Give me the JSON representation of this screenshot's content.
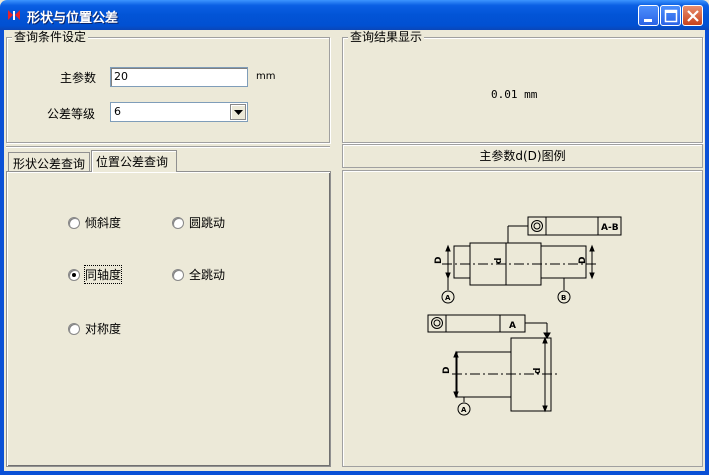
{
  "window": {
    "title": "形状与位置公差",
    "controls": {
      "minimize": "minimize",
      "maximize": "maximize",
      "close": "close"
    }
  },
  "query_settings": {
    "title": "查询条件设定",
    "main_param_label": "主参数",
    "main_param_value": "20",
    "main_param_unit": "mm",
    "grade_label": "公差等级",
    "grade_value": "6"
  },
  "tabs": [
    {
      "label": "形状公差查询",
      "active": false
    },
    {
      "label": "位置公差查询",
      "active": true
    }
  ],
  "radios": [
    {
      "label": "倾斜度",
      "checked": false
    },
    {
      "label": "圆跳动",
      "checked": false
    },
    {
      "label": "同轴度",
      "checked": true
    },
    {
      "label": "全跳动",
      "checked": false
    },
    {
      "label": "对称度",
      "checked": false
    }
  ],
  "results": {
    "title": "查询结果显示",
    "value_text": "0.01 mm"
  },
  "legend": {
    "title": "主参数d(D)图例",
    "top_fcf_datum": "A-B",
    "bottom_fcf_datum": "A",
    "datum_a": "A",
    "datum_b": "B",
    "dim_D": "D",
    "dim_d": "d"
  },
  "icons": [
    "app-icon",
    "minimize-icon",
    "maximize-icon",
    "close-icon",
    "dropdown-arrow-icon"
  ]
}
